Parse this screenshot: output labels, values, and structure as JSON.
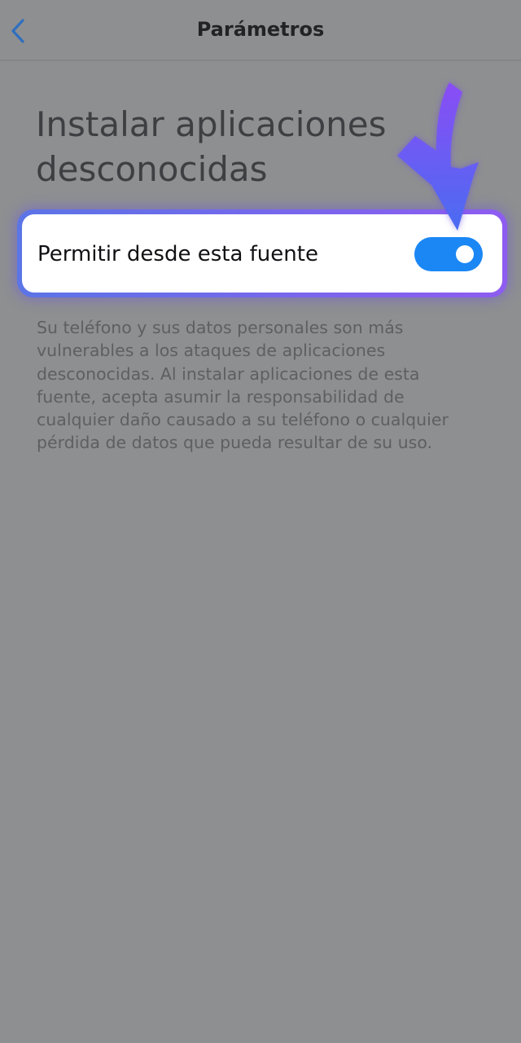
{
  "header": {
    "back_icon": "chevron-left-icon",
    "title": "Parámetros"
  },
  "page": {
    "heading": "Instalar aplicaciones desconocidas"
  },
  "setting": {
    "label": "Permitir desde esta fuente",
    "toggle_state": "on"
  },
  "warning": {
    "text": "Su teléfono y sus datos personales son más vulnerables a los ataques de aplicaciones desconocidas. Al instalar aplicaciones de esta fuente, acepta asumir la responsabilidad de cualquier daño causado a su teléfono o cualquier pérdida de datos que pueda resultar de su uso."
  },
  "overlay": {
    "arrow_icon": "arrow-down-icon"
  },
  "colors": {
    "accent": "#1a87f5",
    "overlay_dim": "#8e8f91",
    "highlight_border_start": "#5b74e6",
    "highlight_border_end": "#8e5cf0",
    "arrow_top": "#8a4df5",
    "arrow_bottom": "#4a6cf2"
  }
}
